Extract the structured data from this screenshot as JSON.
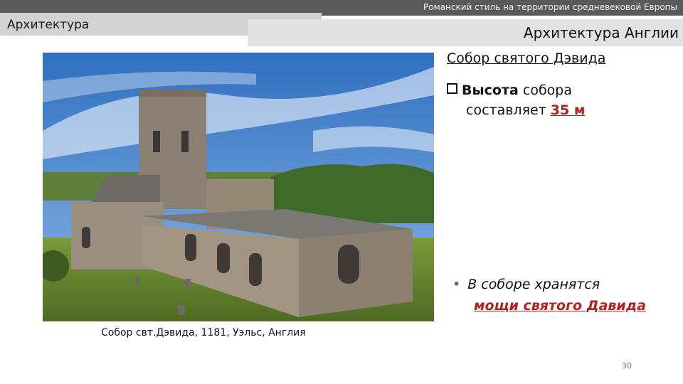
{
  "header": {
    "subtitle": "Романский стиль на территории средневековой Европы",
    "section": "Архитектура",
    "title": "Архитектура Англии"
  },
  "slide": {
    "heading": "Собор святого Дэвида",
    "height_bold": "Высота",
    "height_rest": " собора",
    "height_line2": "составляет ",
    "height_value": "35 м",
    "relic_line1": "В соборе хранятся",
    "relic_line2a": "мощи ",
    "relic_line2b": "святого Давида",
    "caption": "Собор свт.Дэвида, 1181, Уэльс, Англия",
    "page_number": "30"
  },
  "colors": {
    "accent": "#b22222",
    "bullet": "#2f6fb0",
    "header_dark": "#5a5a5a"
  }
}
